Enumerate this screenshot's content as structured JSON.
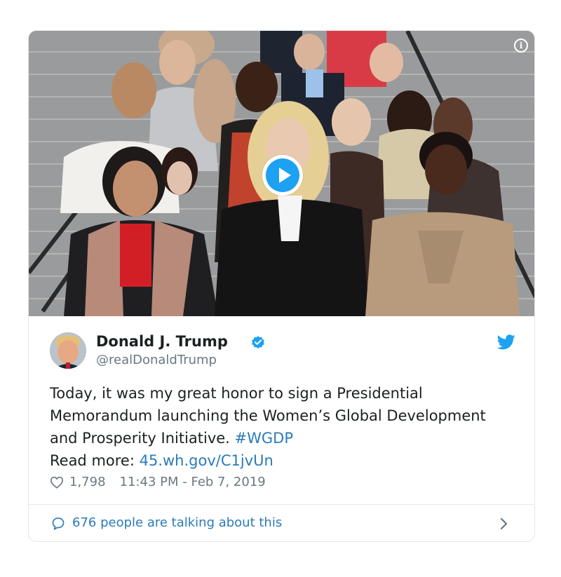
{
  "tweet": {
    "author_name": "Donald J. Trump",
    "handle": "@realDonaldTrump",
    "text_main": "Today, it was my great honor to sign a Presidential Memorandum launching the Women’s Global Development and Prosperity Initiative. ",
    "hashtag": "#WGDP",
    "read_more_label": "Read more: ",
    "link_text": "45.wh.gov/C1jvUn",
    "likes": "1,798",
    "timestamp": "11:43 PM - Feb 7, 2019",
    "talking": "676 people are talking about this"
  },
  "media": {
    "info_label": "i"
  },
  "colors": {
    "accent": "#1da1f2",
    "link": "#2b7bb9",
    "muted": "#697882",
    "border": "#e1e8ed"
  },
  "icons": {
    "info": "info-icon",
    "play": "play-icon",
    "verified": "verified-badge-icon",
    "twitter": "twitter-bird-icon",
    "like": "heart-icon",
    "reply": "speech-bubble-icon",
    "chevron": "chevron-right-icon"
  }
}
